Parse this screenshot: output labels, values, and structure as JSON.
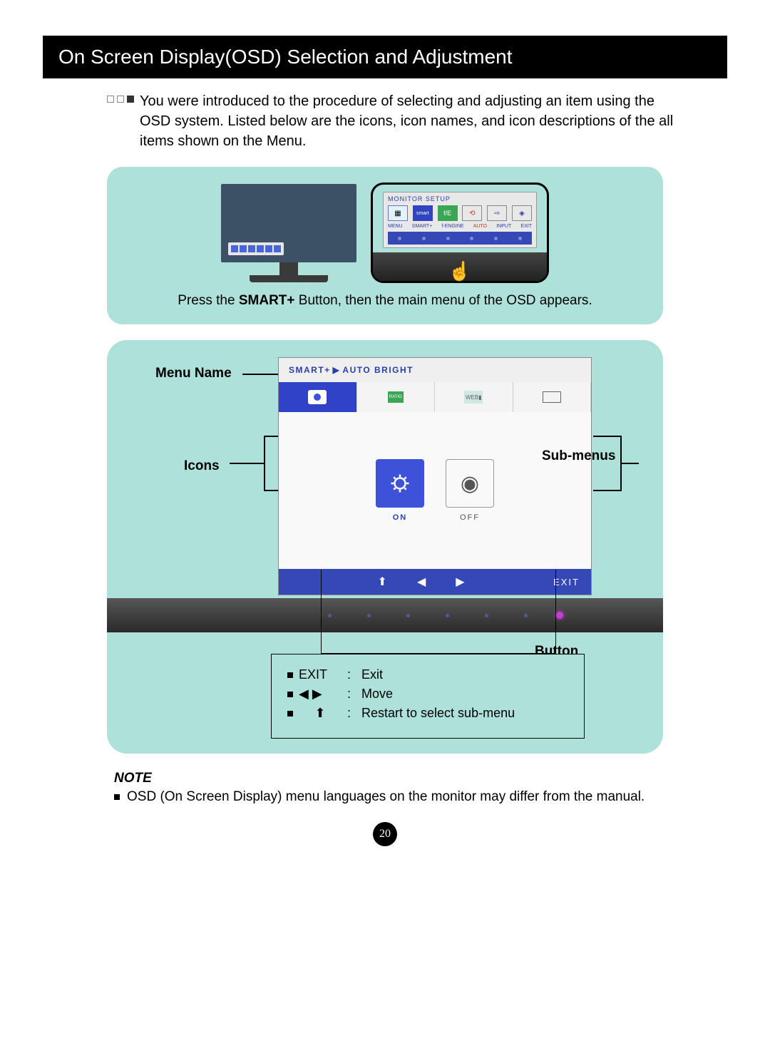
{
  "title": "On Screen Display(OSD) Selection and Adjustment",
  "intro": "You were introduced to the procedure of selecting and adjusting an item using the OSD system. Listed below are the icons, icon names, and icon descriptions of the all items shown on the Menu.",
  "top_panel": {
    "zoom_title": "MONITOR SETUP",
    "zoom_labels": {
      "menu": "MENU",
      "smart": "SMART+",
      "engine": "f-ENGINE",
      "auto": "AUTO",
      "input": "INPUT",
      "exit": "EXIT"
    },
    "caption_prefix": "Press the ",
    "caption_bold": "SMART+",
    "caption_suffix": " Button, then the main menu of the OSD appears."
  },
  "big_panel": {
    "osd_title_left": "SMART+",
    "osd_title_right": "AUTO BRIGHT",
    "submenu_on": "ON",
    "submenu_off": "OFF",
    "nav_exit": "EXIT",
    "labels": {
      "menu_name": "Menu Name",
      "icons": "Icons",
      "submenus": "Sub-menus",
      "button_tip": "Button Tip"
    },
    "tips": {
      "exit_key": "EXIT",
      "exit_desc": "Exit",
      "move_key": "◀ ▶",
      "move_desc": "Move",
      "restart_desc": "Restart to select sub-menu"
    }
  },
  "note": {
    "label": "NOTE",
    "text": "OSD (On Screen Display) menu languages on the monitor may differ from the manual."
  },
  "page_number": "20"
}
